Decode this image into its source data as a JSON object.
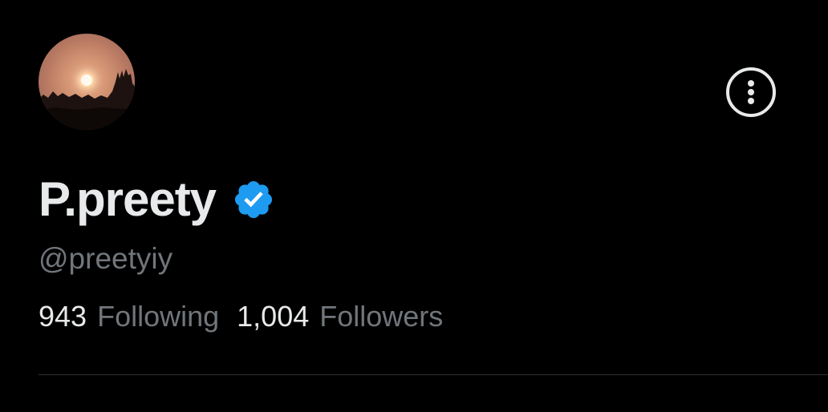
{
  "profile": {
    "display_name": "P.preety",
    "handle": "@preetyiy",
    "verified": true,
    "avatar": {
      "description_icon": "sunset-avatar"
    },
    "stats": [
      {
        "count": "943",
        "label": "Following"
      },
      {
        "count": "1,004",
        "label": "Followers"
      }
    ]
  },
  "actions": {
    "more_icon": "more-vertical-icon"
  },
  "colors": {
    "background": "#000000",
    "primary_text": "#e7e9ea",
    "secondary_text": "#71767b",
    "verified_blue": "#1d9bf0",
    "divider": "#2f3336"
  }
}
